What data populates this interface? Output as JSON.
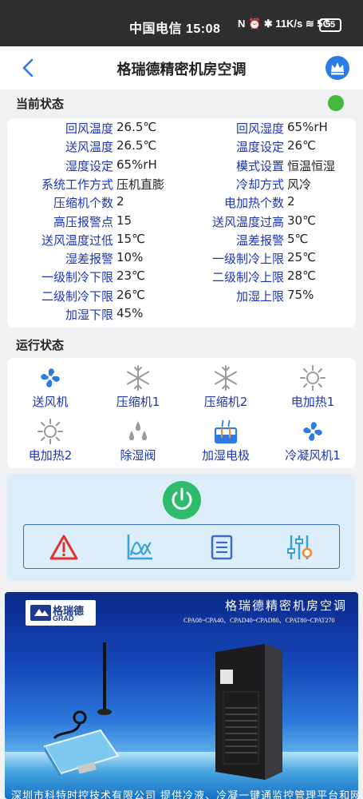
{
  "statusbar": {
    "carrier_time": "中国电信 15:08",
    "icons_text": "N ⏰ ✱ 11K/s ≋ 5G",
    "battery": "55"
  },
  "header": {
    "title": "格瑞德精密机房空调"
  },
  "current_status": {
    "heading": "当前状态",
    "indicator_color": "#46b83d",
    "rows": [
      {
        "l_label": "回风温度",
        "l_value": "26.5℃",
        "r_label": "回风湿度",
        "r_value": "65%rH"
      },
      {
        "l_label": "送风温度",
        "l_value": "26.5℃",
        "r_label": "温度设定",
        "r_value": "26℃"
      },
      {
        "l_label": "湿度设定",
        "l_value": "65%rH",
        "r_label": "模式设置",
        "r_value": "恒温恒湿"
      },
      {
        "l_label": "系统工作方式",
        "l_value": "压机直膨",
        "r_label": "冷却方式",
        "r_value": "风冷"
      },
      {
        "l_label": "压缩机个数",
        "l_value": "2",
        "r_label": "电加热个数",
        "r_value": "2"
      },
      {
        "l_label": "高压报警点",
        "l_value": "15",
        "r_label": "送风温度过高",
        "r_value": "30℃"
      },
      {
        "l_label": "送风温度过低",
        "l_value": "15℃",
        "r_label": "温差报警",
        "r_value": "5℃"
      },
      {
        "l_label": "湿差报警",
        "l_value": "10%",
        "r_label": "一级制冷上限",
        "r_value": "25℃"
      },
      {
        "l_label": "一级制冷下限",
        "l_value": "23℃",
        "r_label": "二级制冷上限",
        "r_value": "28℃"
      },
      {
        "l_label": "二级制冷下限",
        "l_value": "26℃",
        "r_label": "加湿上限",
        "r_value": "75%"
      },
      {
        "l_label": "加湿下限",
        "l_value": "45%",
        "r_label": "",
        "r_value": ""
      }
    ]
  },
  "run_status": {
    "heading": "运行状态",
    "items": [
      {
        "label": "送风机",
        "icon": "fan-icon",
        "active": true
      },
      {
        "label": "压缩机1",
        "icon": "snowflake-icon",
        "active": false
      },
      {
        "label": "压缩机2",
        "icon": "snowflake-icon",
        "active": false
      },
      {
        "label": "电加热1",
        "icon": "sun-icon",
        "active": false
      },
      {
        "label": "电加热2",
        "icon": "sun-icon",
        "active": false
      },
      {
        "label": "除湿阀",
        "icon": "droplets-icon",
        "active": false
      },
      {
        "label": "加湿电极",
        "icon": "humidifier-icon",
        "active": true
      },
      {
        "label": "冷凝风机1",
        "icon": "fan-icon",
        "active": true
      }
    ]
  },
  "controls": {
    "power_color": "#2fbb6c",
    "tools": [
      "alarm-icon",
      "chart-icon",
      "list-icon",
      "settings-sliders-icon"
    ]
  },
  "banner": {
    "logo_text": "格瑞德",
    "logo_sub": "GRAD",
    "title": "格瑞德精密机房空调",
    "models": "CPA08~CPA40、CPAD40~CPAD80、CPAT80~CPAT270",
    "footer": "深圳市科特时控技术有限公司   提供冷液、冷凝一键通监控管理平台和网关"
  },
  "colors": {
    "accent_blue": "#1d36b8",
    "active_icon": "#2e7ce3",
    "inactive_icon": "#9a9a9a"
  }
}
